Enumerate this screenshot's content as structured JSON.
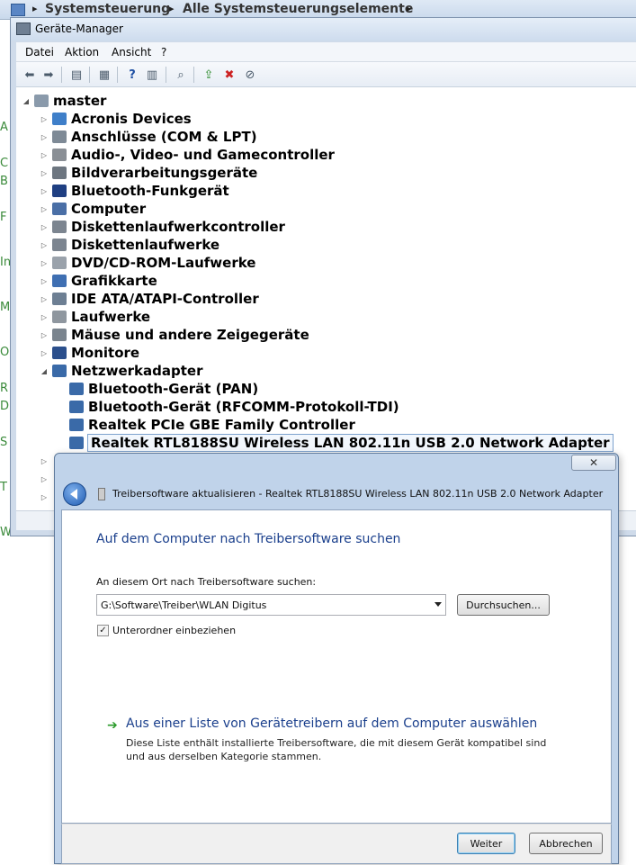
{
  "explorer": {
    "address": [
      "Systemsteuerung",
      "Alle Systemsteuerungselemente"
    ],
    "left_letters": [
      "A",
      "C",
      "B",
      "F",
      "In",
      "M",
      "O",
      "R",
      "D",
      "S",
      "T"
    ],
    "bottom_text": "Windows"
  },
  "devmgr": {
    "title": "Geräte-Manager",
    "menu": [
      "Datei",
      "Aktion",
      "Ansicht",
      "?"
    ],
    "tree_root": "master",
    "categories": [
      "Acronis Devices",
      "Anschlüsse (COM & LPT)",
      "Audio-, Video- und Gamecontroller",
      "Bildverarbeitungsgeräte",
      "Bluetooth-Funkgerät",
      "Computer",
      "Diskettenlaufwerkcontroller",
      "Diskettenlaufwerke",
      "DVD/CD-ROM-Laufwerke",
      "Grafikkarte",
      "IDE ATA/ATAPI-Controller",
      "Laufwerke",
      "Mäuse und andere Zeigegeräte",
      "Monitore",
      "Netzwerkadapter"
    ],
    "network_children": [
      "Bluetooth-Gerät (PAN)",
      "Bluetooth-Gerät (RFCOMM-Protokoll-TDI)",
      "Realtek PCIe GBE Family Controller",
      "Realtek RTL8188SU Wireless LAN 802.11n USB 2.0 Network Adapter"
    ]
  },
  "wizard": {
    "close_glyph": "✕",
    "title": "Treibersoftware aktualisieren - Realtek RTL8188SU Wireless LAN 802.11n USB 2.0 Network Adapter",
    "heading": "Auf dem Computer nach Treibersoftware suchen",
    "search_label": "An diesem Ort nach Treibersoftware suchen:",
    "path_value": "G:\\Software\\Treiber\\WLAN Digitus",
    "browse_button": "Durchsuchen...",
    "subfolder_checked": true,
    "subfolder_label": "Unterordner einbeziehen",
    "choose_title": "Aus einer Liste von Gerätetreibern auf dem Computer auswählen",
    "choose_desc": "Diese Liste enthält installierte Treibersoftware, die mit diesem Gerät kompatibel sind und aus derselben Kategorie stammen.",
    "next_button": "Weiter",
    "cancel_button": "Abbrechen"
  }
}
